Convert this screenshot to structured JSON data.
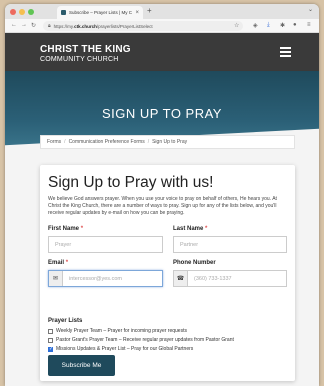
{
  "browser": {
    "tab_title": "Subscribe – Prayer Lists | My Ch",
    "tab_close": "×",
    "new_tab": "+",
    "tab_menu": "⌄",
    "url_prefix": "https://my.",
    "url_domain": "ctk.church",
    "url_path": "/prayerlists/PrayerListSelect"
  },
  "site": {
    "name_line1": "CHRIST THE KING",
    "name_line2": "COMMUNITY CHURCH"
  },
  "hero": {
    "title": "SIGN UP TO PRAY"
  },
  "breadcrumb": [
    "Forms",
    "Communication Preference Forms",
    "Sign Up to Pray"
  ],
  "breadcrumb_sep": "/",
  "form": {
    "title": "Sign Up to Pray with us!",
    "intro": "We believe God answers prayer. When you use your voice to pray on behalf of others, He hears you. At Christ the King Church, there are a number of ways to pray. Sign up for any of the lists below, and you'll receive regular updates by e-mail on how you can be praying.",
    "required_mark": "*",
    "first_name_label": "First Name",
    "first_name_placeholder": "Prayer",
    "last_name_label": "Last Name",
    "last_name_placeholder": "Partner",
    "email_label": "Email",
    "email_placeholder": "intercessor@yes.com",
    "phone_label": "Phone Number",
    "phone_placeholder": "(360) 733-1337",
    "lists_label": "Prayer Lists",
    "lists": [
      {
        "label": "Weekly Prayer Team – Prayer for incoming prayer requests",
        "checked": false
      },
      {
        "label": "Pastor Grant's Prayer Team – Receive regular prayer updates from Pastor Grant",
        "checked": false
      },
      {
        "label": "Missions Updates & Prayer List – Pray for our Global Partners",
        "checked": true
      }
    ],
    "submit_label": "Subscribe Me"
  },
  "colors": {
    "header_bg": "#3a3a3a",
    "hero_teal": "#2b6077",
    "button": "#1f4a5c",
    "checkbox": "#2e6fd8"
  }
}
